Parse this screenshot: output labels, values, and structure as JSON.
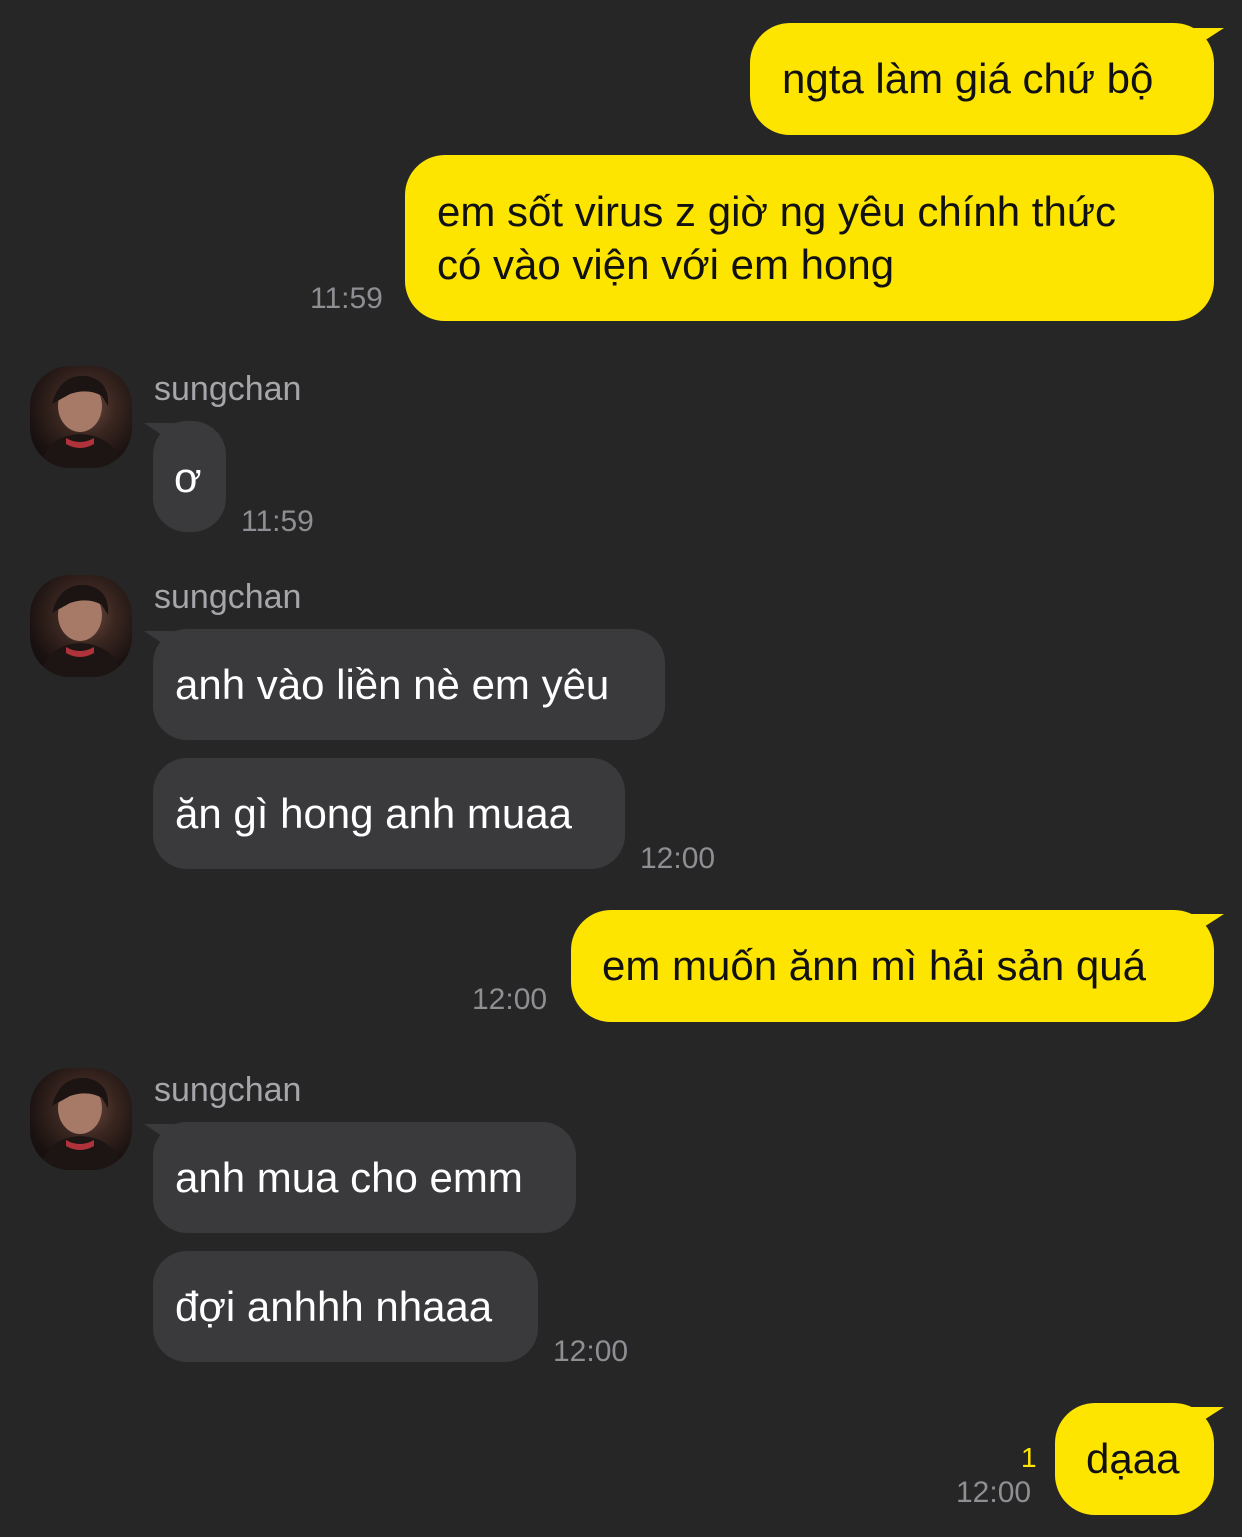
{
  "messages": {
    "m1": {
      "text": "ngta làm giá chứ bộ"
    },
    "m2": {
      "line1": "em sốt virus z giờ ng yêu chính thức",
      "line2": "có vào viện với em hong",
      "time": "11:59"
    },
    "m3": {
      "sender": "sungchan",
      "text": "ơ",
      "time": "11:59"
    },
    "m4": {
      "sender": "sungchan",
      "text1": "anh vào liền nè em yêu",
      "text2": "ăn gì hong anh muaa",
      "time": "12:00"
    },
    "m5": {
      "text": "em muốn ănn mì hải sản quá",
      "time": "12:00"
    },
    "m6": {
      "sender": "sungchan",
      "text1": "anh mua cho emm",
      "text2": "đợi anhhh nhaaa",
      "time": "12:00"
    },
    "m7": {
      "text": "dạaa",
      "time": "12:00",
      "unread": "1"
    }
  },
  "colors": {
    "outgoing": "#FEE500",
    "incoming": "#3A3A3C",
    "background": "#262627"
  },
  "icons": {
    "avatar": "profile-photo"
  }
}
